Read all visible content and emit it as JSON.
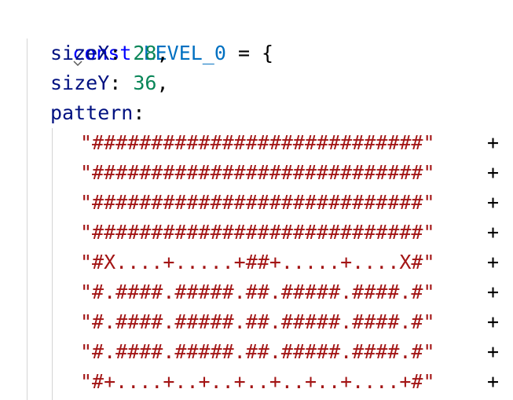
{
  "header": {
    "keyword": "const",
    "name": "LEVEL_0",
    "assign": " = {",
    "fold_icon": "chevron-down-icon"
  },
  "fields": [
    {
      "key": "sizeX",
      "sep": ": ",
      "value": "28",
      "trail": ","
    },
    {
      "key": "sizeY",
      "sep": ": ",
      "value": "36",
      "trail": ","
    }
  ],
  "pattern": {
    "key": "pattern",
    "sep": ":",
    "plus": "+",
    "rows": [
      "\"############################\"",
      "\"############################\"",
      "\"############################\"",
      "\"############################\"",
      "\"#X....+.....+##+.....+....X#\"",
      "\"#.####.#####.##.#####.####.#\"",
      "\"#.####.#####.##.#####.####.#\"",
      "\"#.####.#####.##.#####.####.#\"",
      "\"#+....+..+..+..+..+..+....+#\""
    ]
  },
  "colors": {
    "keyword": "#0000ff",
    "constant": "#0070c1",
    "property": "#001080",
    "number": "#098658",
    "string": "#a31515"
  }
}
